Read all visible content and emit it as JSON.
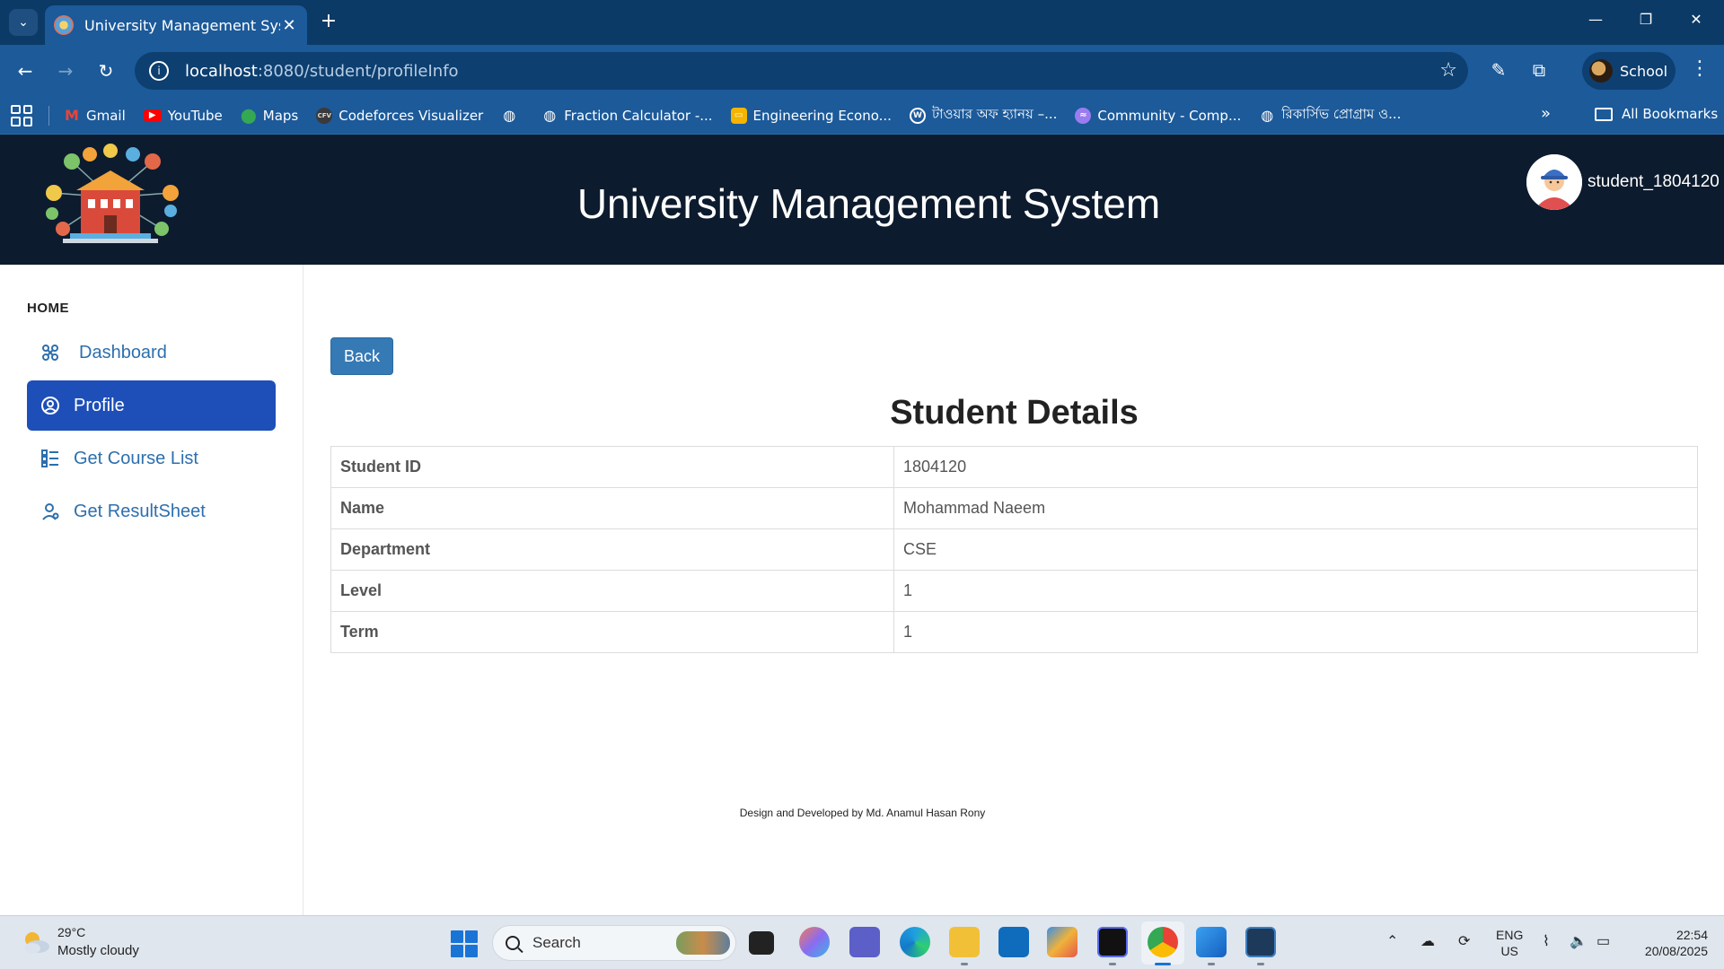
{
  "browser": {
    "tab_title": "University Management System",
    "url_host": "localhost",
    "url_path": ":8080/student/profileInfo",
    "profile_label": "School",
    "bookmarks": [
      {
        "label": "Gmail",
        "icon": "gmail-icon",
        "color": "#ea4335"
      },
      {
        "label": "YouTube",
        "icon": "youtube-icon",
        "color": "#ff0000"
      },
      {
        "label": "Maps",
        "icon": "maps-icon",
        "color": "#34a853"
      },
      {
        "label": "Codeforces Visualizer",
        "icon": "cfv-icon",
        "color": "#444444"
      },
      {
        "label": "",
        "icon": "globe-icon",
        "color": "#ffffff"
      },
      {
        "label": "Fraction Calculator -...",
        "icon": "globe-icon",
        "color": "#ffffff"
      },
      {
        "label": "Engineering Econo...",
        "icon": "slides-icon",
        "color": "#f4b400"
      },
      {
        "label": "টাওয়ার অফ হ্যানয় –...",
        "icon": "wordpress-icon",
        "color": "#ffffff"
      },
      {
        "label": "Community - Comp...",
        "icon": "community-icon",
        "color": "#9a7cf0"
      },
      {
        "label": "রিকার্সিভ প্রোগ্রাম ও...",
        "icon": "globe-icon",
        "color": "#ffffff"
      }
    ],
    "all_bookmarks_label": "All Bookmarks"
  },
  "app": {
    "title": "University Management System",
    "username": "student_1804120"
  },
  "sidebar": {
    "heading": "HOME",
    "items": [
      {
        "label": "Dashboard",
        "icon": "dashboard-icon",
        "active": false
      },
      {
        "label": "Profile",
        "icon": "profile-icon",
        "active": true
      },
      {
        "label": "Get Course List",
        "icon": "list-icon",
        "active": false
      },
      {
        "label": "Get ResultSheet",
        "icon": "person-icon",
        "active": false
      }
    ]
  },
  "main": {
    "back_label": "Back",
    "title": "Student Details",
    "rows": [
      {
        "label": "Student ID",
        "value": "1804120"
      },
      {
        "label": "Name",
        "value": "Mohammad Naeem"
      },
      {
        "label": "Department",
        "value": "CSE"
      },
      {
        "label": "Level",
        "value": "1"
      },
      {
        "label": "Term",
        "value": "1"
      }
    ],
    "footer": "Design and Developed by Md. Anamul Hasan Rony"
  },
  "taskbar": {
    "weather_temp": "29°C",
    "weather_desc": "Mostly cloudy",
    "search_placeholder": "Search",
    "lang_top": "ENG",
    "lang_bottom": "US",
    "time": "22:54",
    "date": "20/08/2025"
  },
  "colors": {
    "header_bg": "#0d1b2e",
    "sidebar_active": "#1e4fb8",
    "sidebar_link": "#2d6fad",
    "back_button": "#3579b5"
  }
}
